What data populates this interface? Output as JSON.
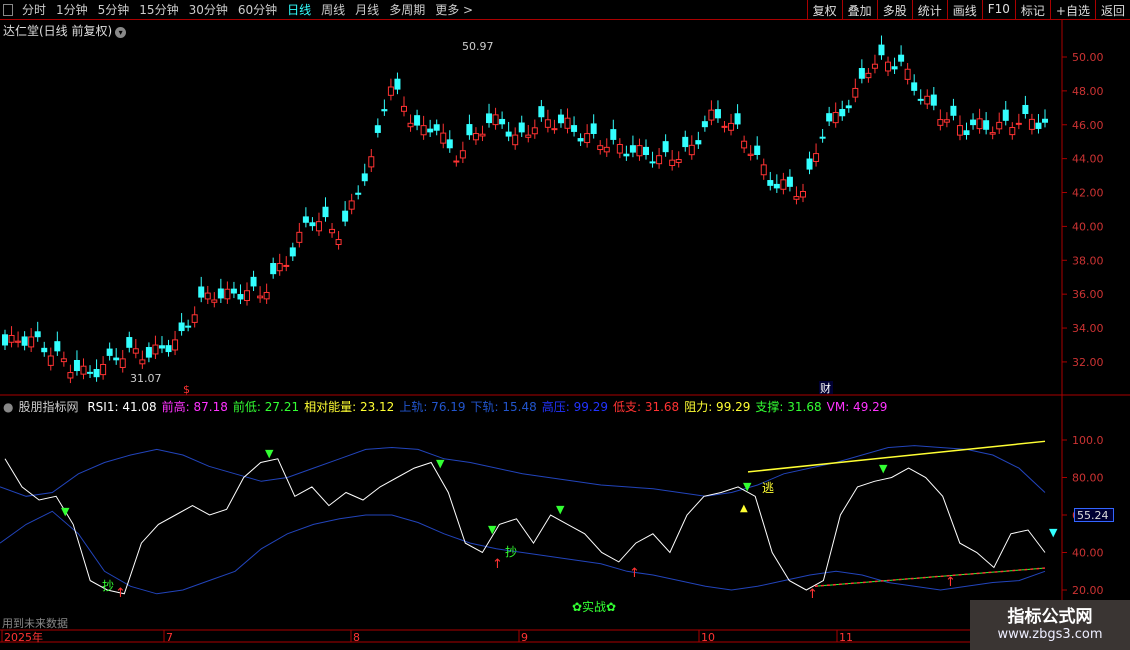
{
  "toolbar": {
    "periods": [
      "分时",
      "1分钟",
      "5分钟",
      "15分钟",
      "30分钟",
      "60分钟",
      "日线",
      "周线",
      "月线",
      "多周期",
      "更多 >"
    ],
    "active": "日线",
    "right_buttons": [
      "复权",
      "叠加",
      "多股",
      "统计",
      "画线",
      "F10",
      "标记",
      "+自选",
      "返回"
    ]
  },
  "chart_title": "达仁堂(日线 前复权)",
  "price_axis": [
    "50.00",
    "48.00",
    "46.00",
    "44.00",
    "42.00",
    "40.00",
    "38.00",
    "36.00",
    "34.00",
    "32.00"
  ],
  "annotations": {
    "high": "50.97",
    "low": "31.07",
    "cai": "财",
    "dollar": "$"
  },
  "price_series": [
    33,
    33.4,
    33.2,
    32.5,
    31.8,
    31.3,
    31.6,
    32.4,
    32.6,
    32.4,
    32.9,
    33.4,
    35.4,
    36,
    35.9,
    36.2,
    36,
    37.3,
    38.5,
    40.5,
    40.2,
    39.5,
    42,
    44,
    48.5,
    47,
    45.5,
    46,
    44,
    45,
    46,
    46.3,
    45,
    46,
    46.2,
    46.1,
    45.4,
    45.1,
    44.8,
    44.5,
    44.3,
    44,
    44.2,
    44.6,
    46.5,
    46.3,
    45.5,
    44,
    42.5,
    42.3,
    42,
    45.5,
    46.5,
    47.5,
    49.5,
    49.8,
    49.6,
    48,
    47,
    46.3,
    45.8,
    46,
    45.8,
    46.2,
    46.3,
    46.1
  ],
  "indicator": {
    "name": "股朋指标网",
    "items": [
      {
        "label": "RSI1",
        "value": "41.08",
        "color": "#ffffff"
      },
      {
        "label": "前高",
        "value": "87.18",
        "color": "#ff33ff"
      },
      {
        "label": "前低",
        "value": "27.21",
        "color": "#33ff33"
      },
      {
        "label": "相对能量",
        "value": "23.12",
        "color": "#ffff33"
      },
      {
        "label": "上轨",
        "value": "76.19",
        "color": "#2255cc"
      },
      {
        "label": "下轨",
        "value": "15.48",
        "color": "#2255cc"
      },
      {
        "label": "高压",
        "value": "99.29",
        "color": "#2233ff"
      },
      {
        "label": "低支",
        "value": "31.68",
        "color": "#ff3333"
      },
      {
        "label": "阻力",
        "value": "99.29",
        "color": "#ffff33"
      },
      {
        "label": "支撑",
        "value": "31.68",
        "color": "#33ff33"
      },
      {
        "label": "VM",
        "value": "49.29",
        "color": "#ff33ff"
      }
    ],
    "axis": [
      "100.0",
      "80.00",
      "60.00",
      "40.00",
      "20.00"
    ],
    "current": "55.24",
    "rsi": [
      90,
      75,
      68,
      70,
      55,
      25,
      20,
      18,
      45,
      55,
      60,
      65,
      60,
      63,
      80,
      88,
      90,
      70,
      75,
      65,
      72,
      68,
      75,
      80,
      85,
      88,
      72,
      45,
      40,
      55,
      58,
      45,
      60,
      55,
      50,
      40,
      35,
      45,
      50,
      40,
      60,
      70,
      72,
      75,
      70,
      40,
      25,
      20,
      25,
      60,
      75,
      78,
      80,
      85,
      80,
      70,
      45,
      40,
      32,
      50,
      52,
      40
    ],
    "upper": [
      75,
      70,
      72,
      82,
      88,
      92,
      95,
      92,
      86,
      82,
      78,
      80,
      85,
      90,
      95,
      96,
      95,
      90,
      88,
      85,
      82,
      80,
      78,
      76,
      75,
      74,
      72,
      70,
      72,
      76,
      82,
      85,
      88,
      92,
      96,
      97,
      96,
      95,
      92,
      85,
      72
    ],
    "lower": [
      45,
      55,
      62,
      50,
      30,
      22,
      18,
      20,
      25,
      30,
      42,
      50,
      55,
      58,
      60,
      60,
      56,
      50,
      45,
      42,
      40,
      38,
      36,
      34,
      30,
      28,
      25,
      22,
      20,
      22,
      25,
      28,
      30,
      28,
      24,
      22,
      20,
      22,
      24,
      25,
      30
    ],
    "labels": {
      "chao": "抄",
      "tao": "逃",
      "shizhan": "✿实战✿"
    }
  },
  "note": "用到未来数据",
  "time_axis": [
    "2025年",
    "7",
    "8",
    "9",
    "10",
    "11"
  ],
  "watermark": {
    "title": "指标公式网",
    "url": "www.zbgs3.com"
  }
}
